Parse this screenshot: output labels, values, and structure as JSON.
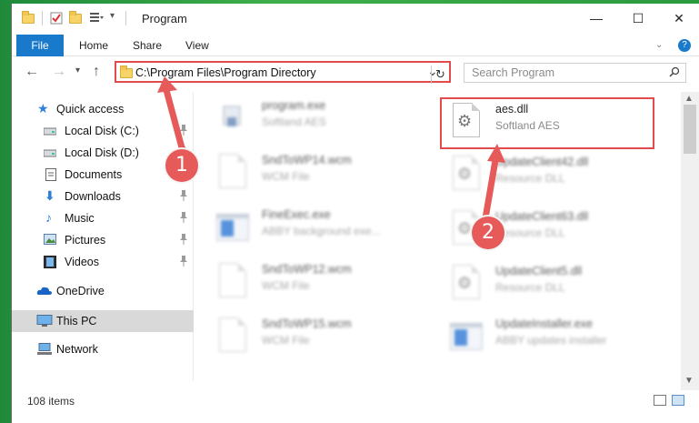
{
  "window": {
    "title": "Program",
    "controls": {
      "minimize": "—",
      "maximize": "☐",
      "close": "✕"
    }
  },
  "ribbon": {
    "tabs": [
      {
        "label": "File",
        "active": true
      },
      {
        "label": "Home"
      },
      {
        "label": "Share"
      },
      {
        "label": "View"
      }
    ],
    "help_icon": "?"
  },
  "navigation": {
    "back": "←",
    "forward": "→",
    "recent": "▾",
    "up": "↑",
    "address": "C:\\Program Files\\Program Directory",
    "address_dropdown": "⌄",
    "refresh": "↻",
    "search_placeholder": "Search Program",
    "search_icon": "⌕"
  },
  "sidebar": {
    "items": [
      {
        "label": "Quick access",
        "icon": "star-icon",
        "pinned": false
      },
      {
        "label": "Local Disk (C:)",
        "icon": "drive-icon",
        "pinned": true
      },
      {
        "label": "Local Disk (D:)",
        "icon": "drive-icon",
        "pinned": true
      },
      {
        "label": "Documents",
        "icon": "documents-icon",
        "pinned": true
      },
      {
        "label": "Downloads",
        "icon": "download-icon",
        "pinned": true
      },
      {
        "label": "Music",
        "icon": "music-icon",
        "pinned": true
      },
      {
        "label": "Pictures",
        "icon": "pictures-icon",
        "pinned": true
      },
      {
        "label": "Videos",
        "icon": "videos-icon",
        "pinned": true
      },
      {
        "label": "OneDrive",
        "icon": "onedrive-icon",
        "pinned": false
      },
      {
        "label": "This PC",
        "icon": "computer-icon",
        "pinned": false,
        "selected": true
      },
      {
        "label": "Network",
        "icon": "network-icon",
        "pinned": false
      }
    ],
    "pin_glyph": "📌"
  },
  "files": [
    {
      "name": "program.exe",
      "type": "Softland AES",
      "icon": "exe-icon",
      "blurred": true
    },
    {
      "name": "aes.dll",
      "type": "Softland AES",
      "icon": "dll-gear-icon",
      "blurred": false,
      "highlighted": true
    },
    {
      "name": "SndToWP14.wcm",
      "type": "WCM File",
      "icon": "file-icon",
      "blurred": true
    },
    {
      "name": "UpdateClient42.dll",
      "type": "Resource DLL",
      "icon": "dll-gear-icon",
      "blurred": true
    },
    {
      "name": "FineExec.exe",
      "type": "ABBY background exe...",
      "icon": "app-icon",
      "blurred": true
    },
    {
      "name": "UpdateClient63.dll",
      "type": "Resource DLL",
      "icon": "dll-gear-icon",
      "blurred": true
    },
    {
      "name": "SndToWP12.wcm",
      "type": "WCM File",
      "icon": "file-icon",
      "blurred": true
    },
    {
      "name": "UpdateClient5.dll",
      "type": "Resource DLL",
      "icon": "dll-gear-icon",
      "blurred": true
    },
    {
      "name": "SndToWP15.wcm",
      "type": "WCM File",
      "icon": "file-icon",
      "blurred": true
    },
    {
      "name": "UpdateInstaller.exe",
      "type": "ABBY updates installer",
      "icon": "app-icon",
      "blurred": true
    }
  ],
  "status": {
    "item_count": "108 items"
  },
  "annotations": [
    {
      "label": "1",
      "color": "#e65a5a"
    },
    {
      "label": "2",
      "color": "#e65a5a"
    }
  ],
  "colors": {
    "accent": "#1979ca",
    "highlight": "#e24b4b",
    "selected": "#d9d9d9"
  }
}
